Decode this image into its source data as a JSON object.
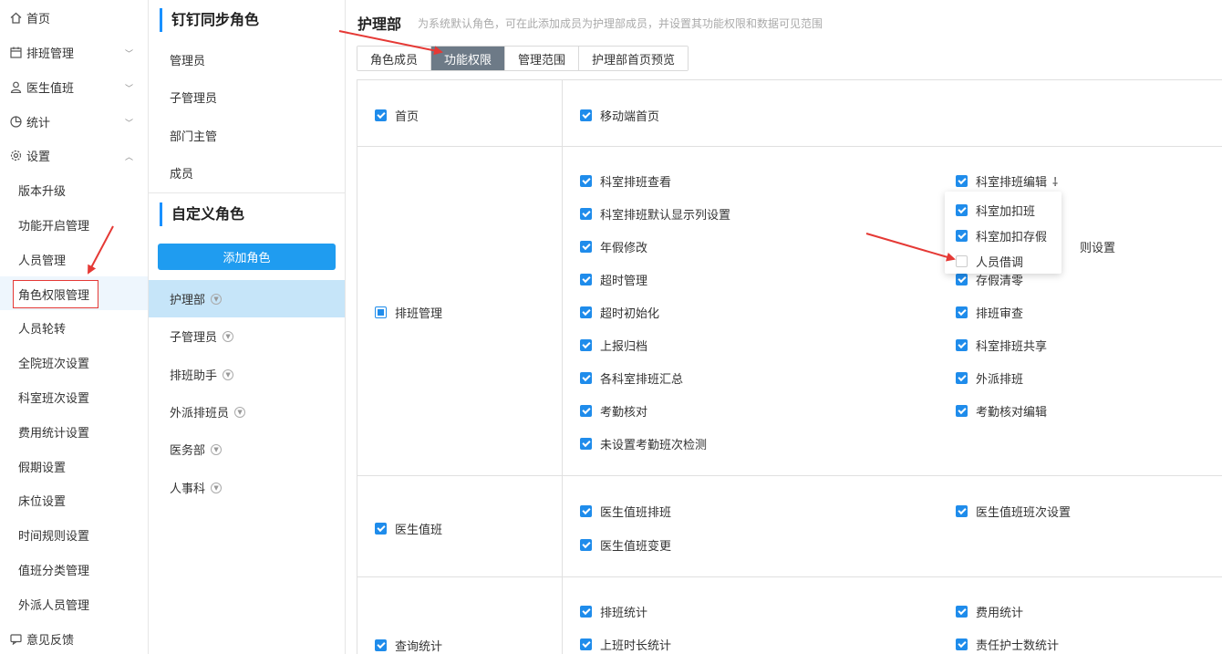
{
  "nav": {
    "home": "首页",
    "schedule": "排班管理",
    "doctor": "医生值班",
    "stats": "统计",
    "settings": "设置",
    "sub": [
      "版本升级",
      "功能开启管理",
      "人员管理",
      "角色权限管理",
      "人员轮转",
      "全院班次设置",
      "科室班次设置",
      "费用统计设置",
      "假期设置",
      "床位设置",
      "时间规则设置",
      "值班分类管理",
      "外派人员管理"
    ],
    "feedback": "意见反馈"
  },
  "roles": {
    "dingtalk_title": "钉钉同步角色",
    "dingtalk": [
      "管理员",
      "子管理员",
      "部门主管",
      "成员"
    ],
    "custom_title": "自定义角色",
    "add_label": "添加角色",
    "custom": [
      "护理部",
      "子管理员",
      "排班助手",
      "外派排班员",
      "医务部",
      "人事科"
    ]
  },
  "main": {
    "title": "护理部",
    "subtitle": "为系统默认角色，可在此添加成员为护理部成员，并设置其功能权限和数据可见范围",
    "tabs": [
      "角色成员",
      "功能权限",
      "管理范围",
      "护理部首页预览"
    ]
  },
  "perms": {
    "home": {
      "label": "首页",
      "items": [
        "移动端首页"
      ]
    },
    "schedule": {
      "label": "排班管理",
      "left": [
        "科室排班查看",
        "科室排班默认显示列设置",
        "年假修改",
        "超时管理",
        "超时初始化",
        "上报归档",
        "各科室排班汇总",
        "考勤核对",
        "未设置考勤班次检测"
      ],
      "right": [
        "科室排班编辑",
        "则设置",
        "存假清零",
        "排班审查",
        "科室排班共享",
        "外派排班",
        "考勤核对编辑"
      ]
    },
    "doctor": {
      "label": "医生值班",
      "left": [
        "医生值班排班",
        "医生值班变更"
      ],
      "right": [
        "医生值班班次设置"
      ]
    },
    "stats": {
      "label": "查询统计",
      "left": [
        "排班统计",
        "上班时长统计"
      ],
      "right": [
        "费用统计",
        "责任护士数统计"
      ]
    }
  },
  "popup": [
    "科室加扣班",
    "科室加扣存假",
    "人员借调"
  ],
  "colors": {
    "accent": "#1f8ceb",
    "active_tab": "#6d7a87",
    "highlight": "#e53935",
    "active_role": "#c6e5f9"
  }
}
